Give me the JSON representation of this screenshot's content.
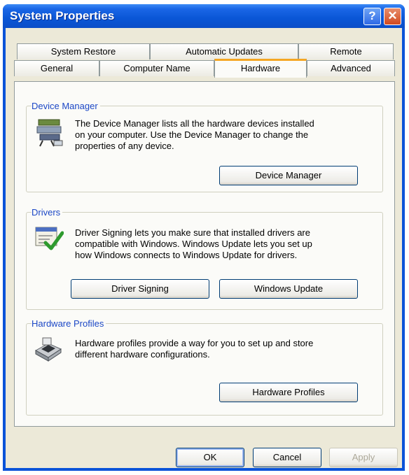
{
  "window": {
    "title": "System Properties",
    "help_glyph": "?",
    "close_glyph": "✕"
  },
  "tabs_row1": [
    "System Restore",
    "Automatic Updates",
    "Remote"
  ],
  "tabs_row2": [
    "General",
    "Computer Name",
    "Hardware",
    "Advanced"
  ],
  "active_tab": "Hardware",
  "device_manager": {
    "title": "Device Manager",
    "lines": [
      "The Device Manager lists all the hardware devices installed",
      "on your computer. Use the Device Manager to change the",
      "properties of any device."
    ],
    "button": "Device Manager",
    "icon": "device-manager-icon"
  },
  "drivers": {
    "title": "Drivers",
    "lines": [
      "Driver Signing lets you make sure that installed drivers are",
      "compatible with Windows. Windows Update lets you set up",
      "how Windows connects to Windows Update for drivers."
    ],
    "button_signing": "Driver Signing",
    "button_update": "Windows Update",
    "icon": "driver-signing-icon"
  },
  "hardware_profiles": {
    "title": "Hardware Profiles",
    "lines": [
      "Hardware profiles provide a way for you to set up and store",
      "different hardware configurations."
    ],
    "button": "Hardware Profiles",
    "icon": "hardware-profile-icon"
  },
  "footer": {
    "ok": "OK",
    "cancel": "Cancel",
    "apply": "Apply"
  },
  "colors": {
    "titlebar": "#0a56d6",
    "group_title": "#1c48c6",
    "tab_highlight": "#f5a623",
    "dialog_bg": "#ece9d8"
  }
}
